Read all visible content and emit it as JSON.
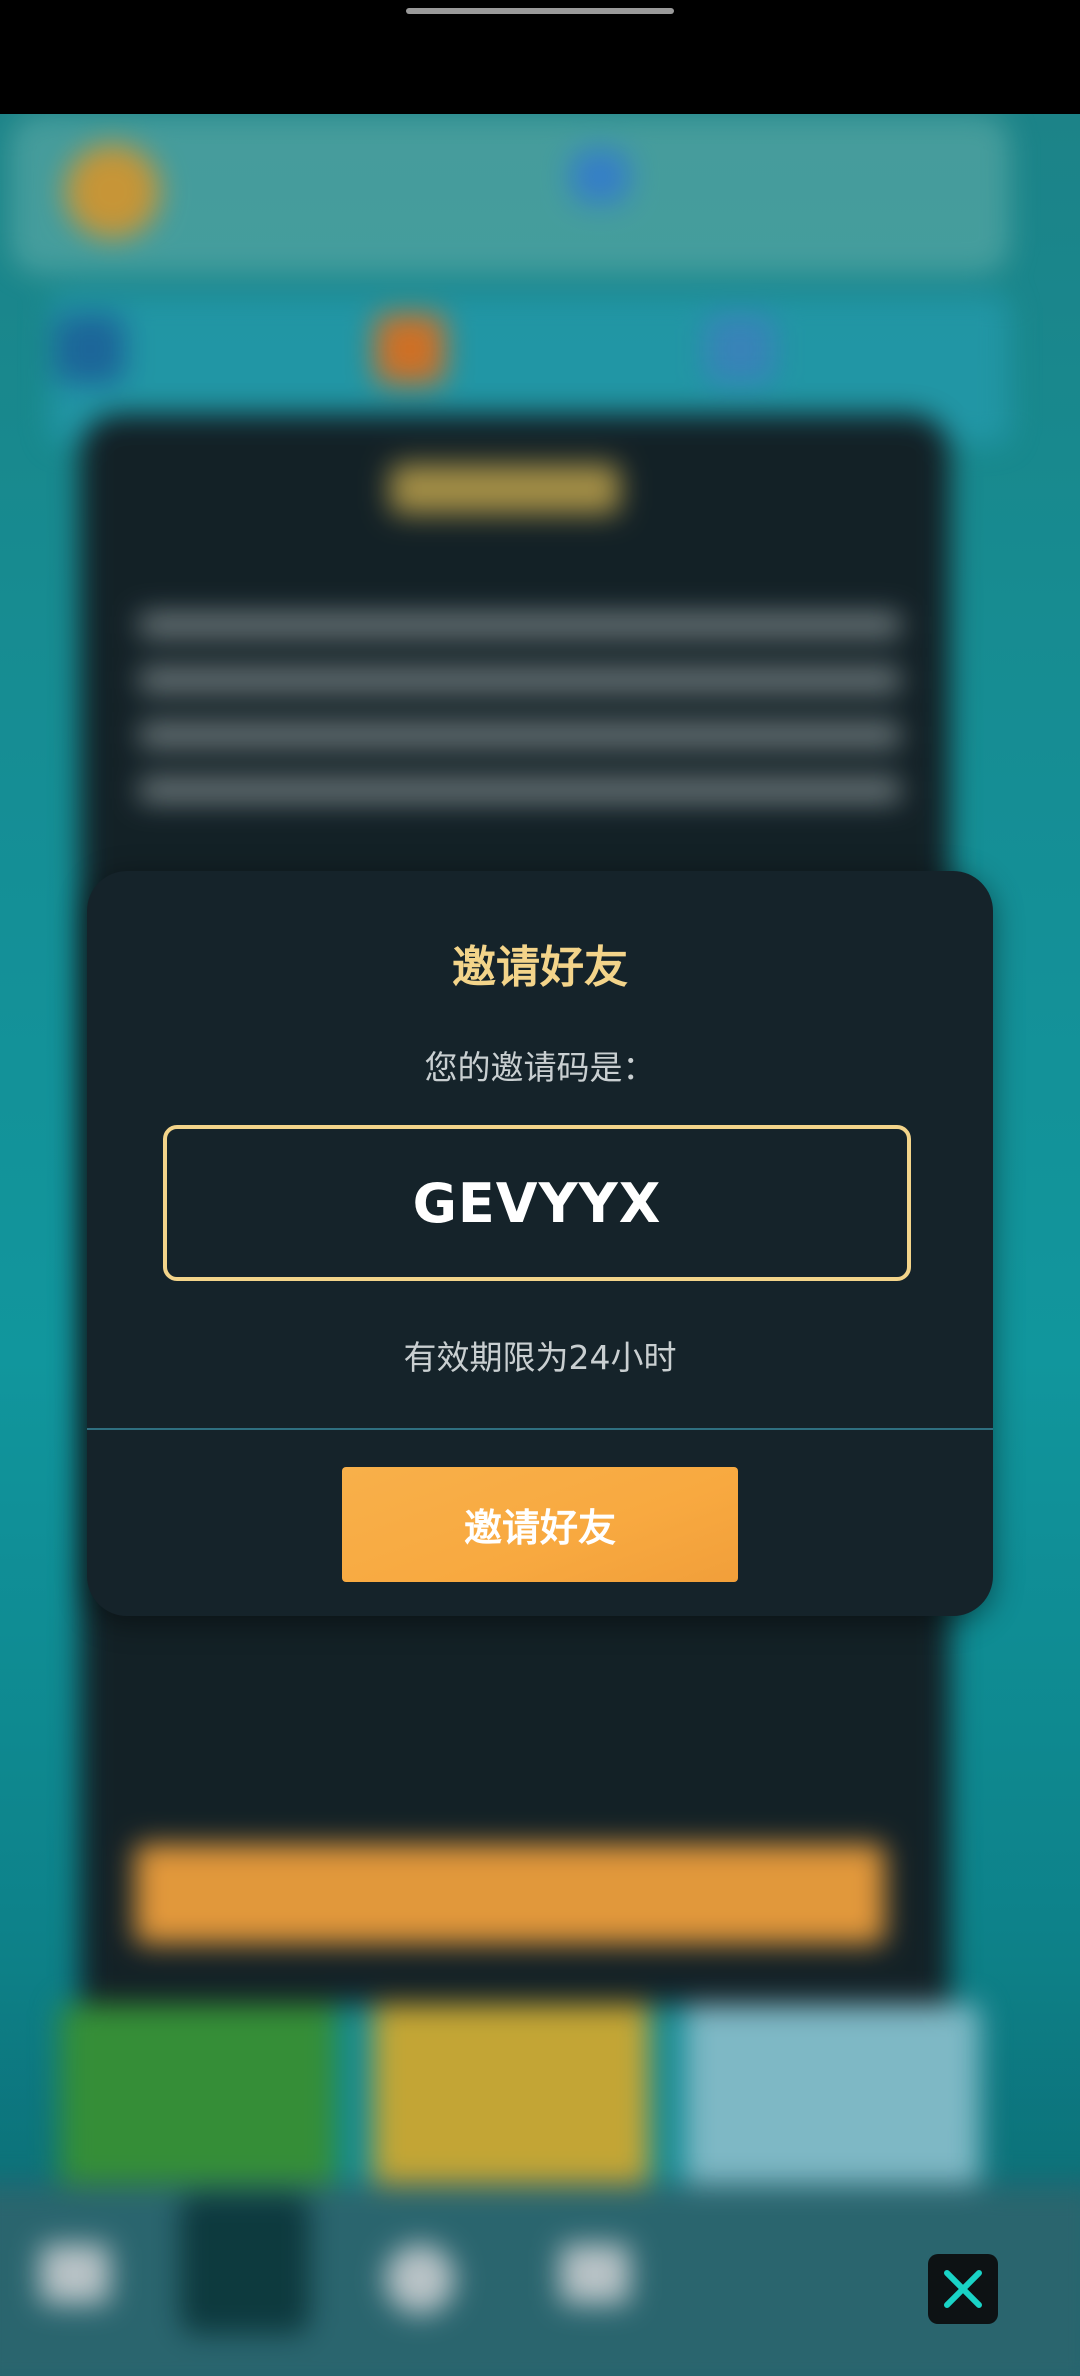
{
  "modal": {
    "title": "邀请好友",
    "subtitle": "您的邀请码是：",
    "invite_code": "GEVYYX",
    "validity": "有效期限为24小时",
    "button_label": "邀请好友"
  },
  "overlay": {
    "close_icon": "close-x-icon"
  },
  "colors": {
    "accent_gold": "#f3d48a",
    "button_orange": "#f8a940",
    "modal_bg": "#15232a",
    "close_icon": "#19d3c6"
  }
}
